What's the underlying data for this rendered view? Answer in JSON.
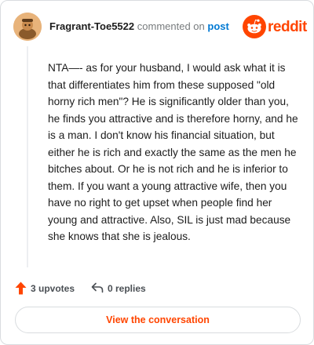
{
  "header": {
    "username": "Fragrant-Toe5522",
    "action_text": "commented on",
    "post_link": "post",
    "brand": "reddit",
    "brand_icon": "reddit-alien-icon",
    "avatar_icon": "snoo-avatar-icon"
  },
  "comment": {
    "text": "NTA—- as for your husband, I would ask what it is that differentiates him from these supposed \"old horny rich men\"? He is significantly older than you, he finds you attractive and is therefore horny, and he is a man. I don't know his financial situation, but either he is rich and exactly the same as the men he bitches about. Or he is not rich and he is inferior to them. If you want a young attractive wife, then you have no right to get upset when people find her young and attractive. Also, SIL is just mad because she knows that she is jealous."
  },
  "footer": {
    "upvotes": "3 upvotes",
    "replies": "0 replies",
    "upvote_icon": "upvote-arrow-icon",
    "reply_icon": "reply-icon"
  },
  "cta": {
    "label": "View the conversation"
  },
  "colors": {
    "brand": "#ff4500",
    "link": "#0079d3",
    "muted": "#787c7e",
    "border": "#d9dcdf"
  }
}
